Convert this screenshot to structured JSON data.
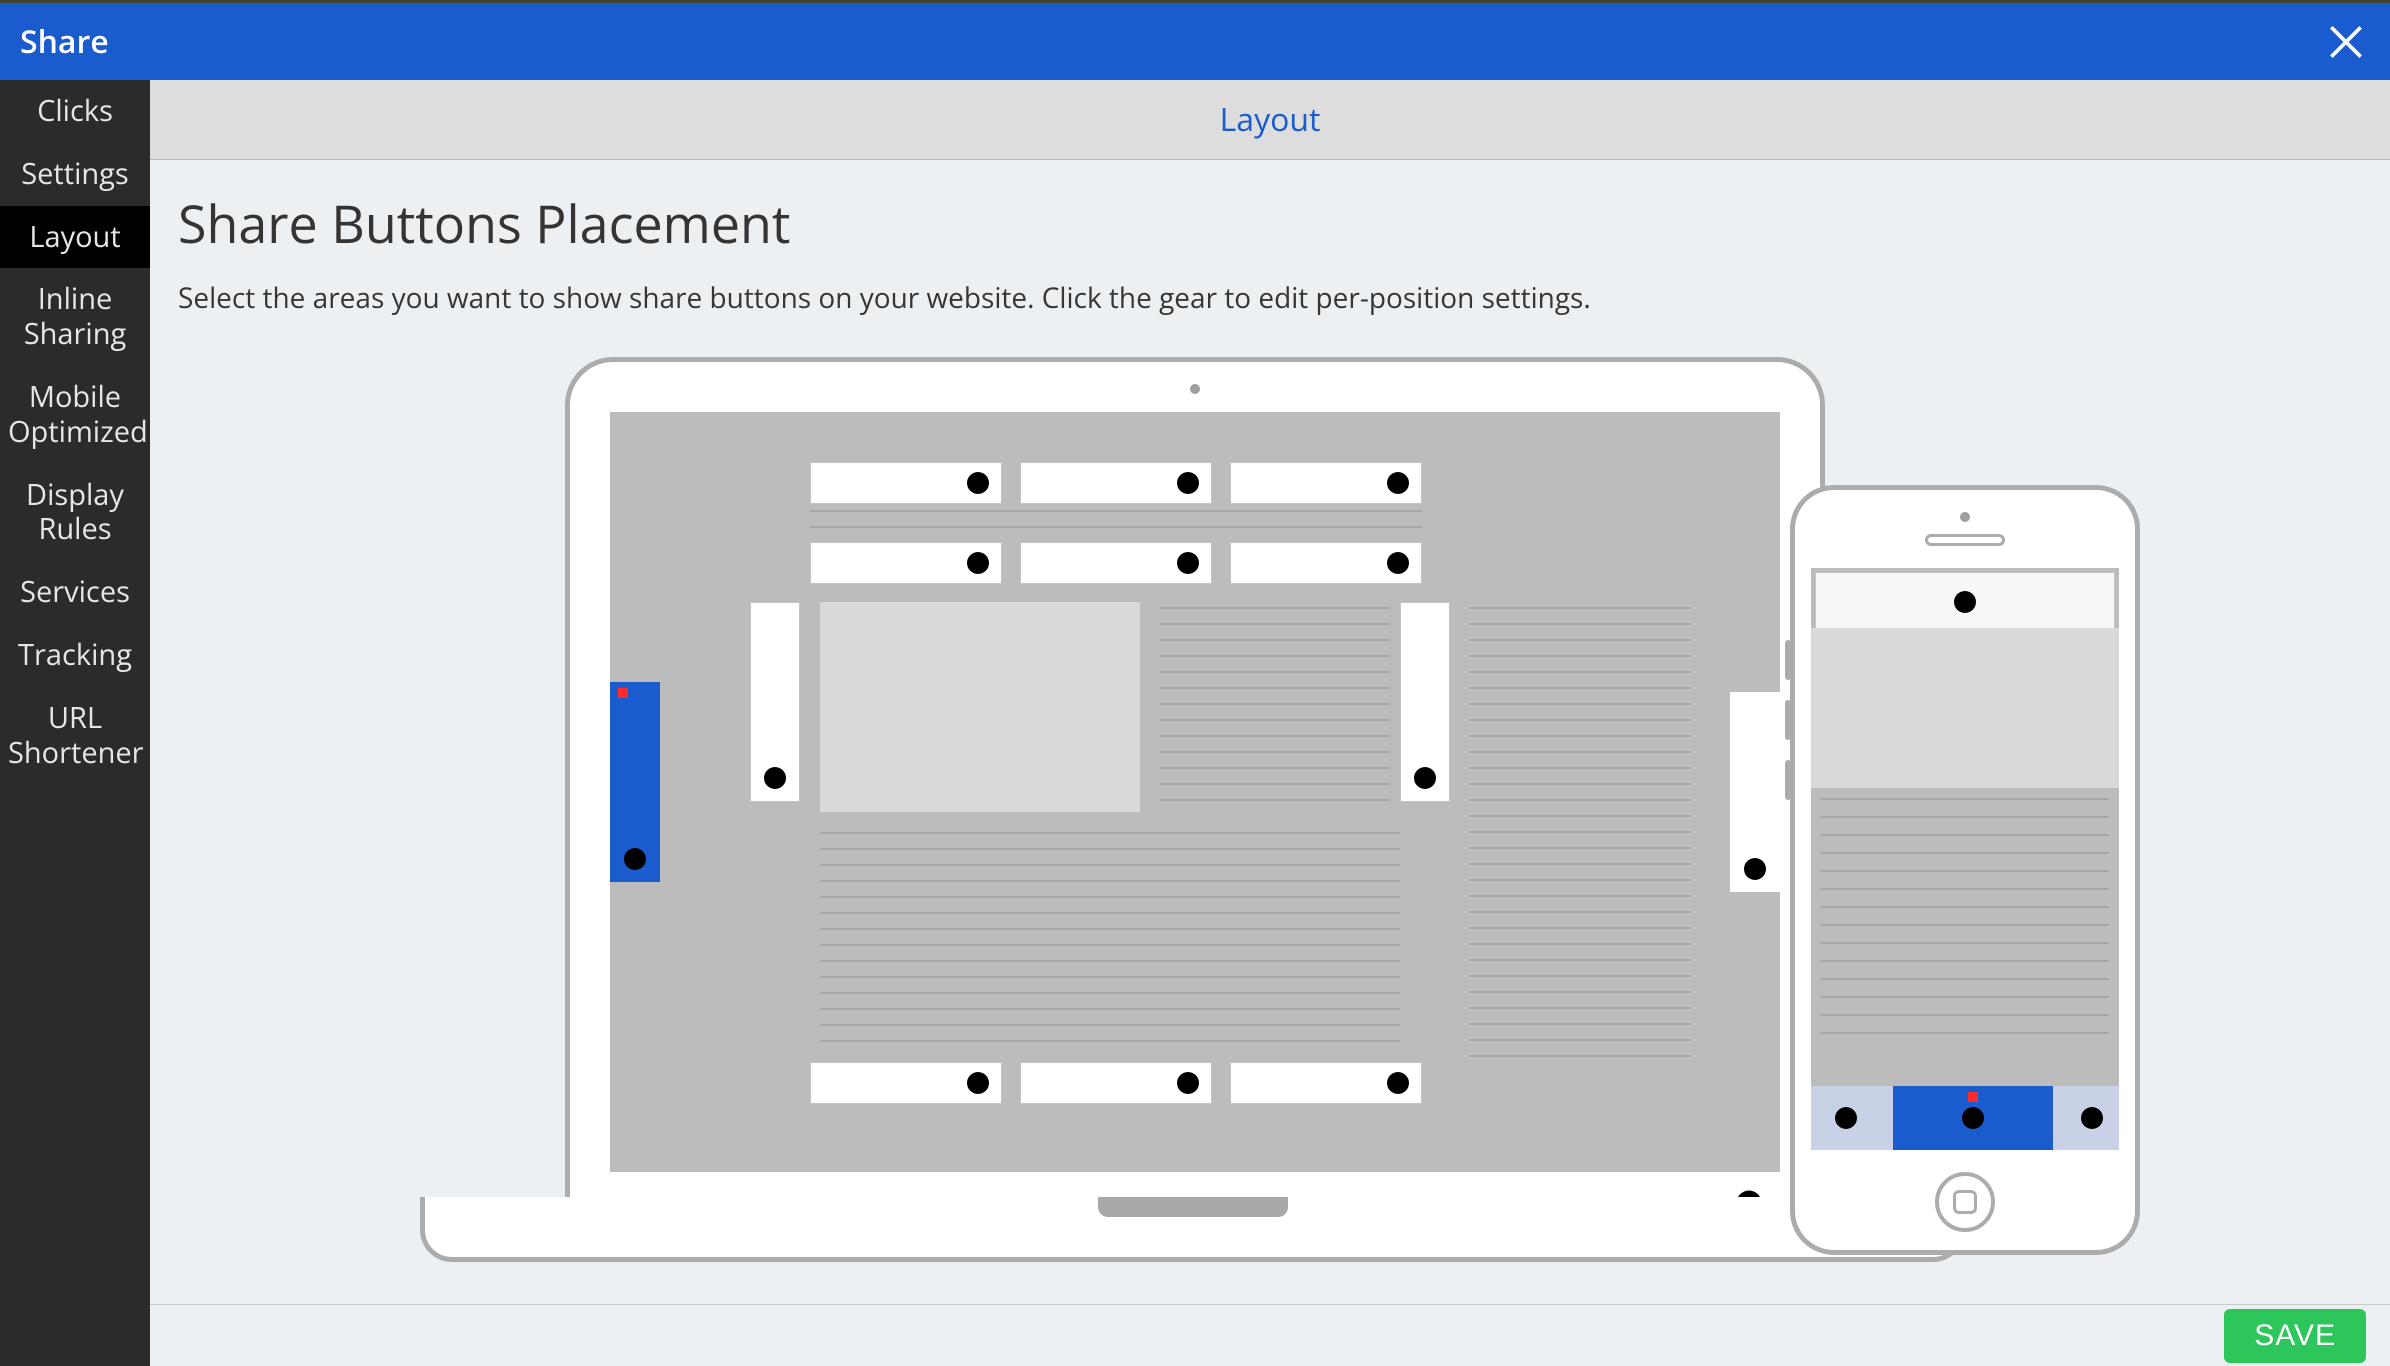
{
  "topbar": {
    "title": "Share"
  },
  "sidebar": {
    "items": [
      {
        "label": "Clicks"
      },
      {
        "label": "Settings"
      },
      {
        "label": "Layout"
      },
      {
        "label": "Inline Sharing"
      },
      {
        "label": "Mobile Optimized"
      },
      {
        "label": "Display Rules"
      },
      {
        "label": "Services"
      },
      {
        "label": "Tracking"
      },
      {
        "label": "URL Shortener"
      }
    ],
    "active_index": 2
  },
  "tabs": {
    "current": "Layout"
  },
  "page": {
    "heading": "Share Buttons Placement",
    "subtext": "Select the areas you want to show share buttons on your website. Click the gear to edit per-position settings."
  },
  "placements": {
    "desktop": {
      "left_floating_enabled": true,
      "left_floating_unsaved": true
    },
    "mobile": {
      "bottom_center_enabled": true,
      "bottom_center_unsaved": true
    }
  },
  "buttons": {
    "save": "SAVE"
  }
}
